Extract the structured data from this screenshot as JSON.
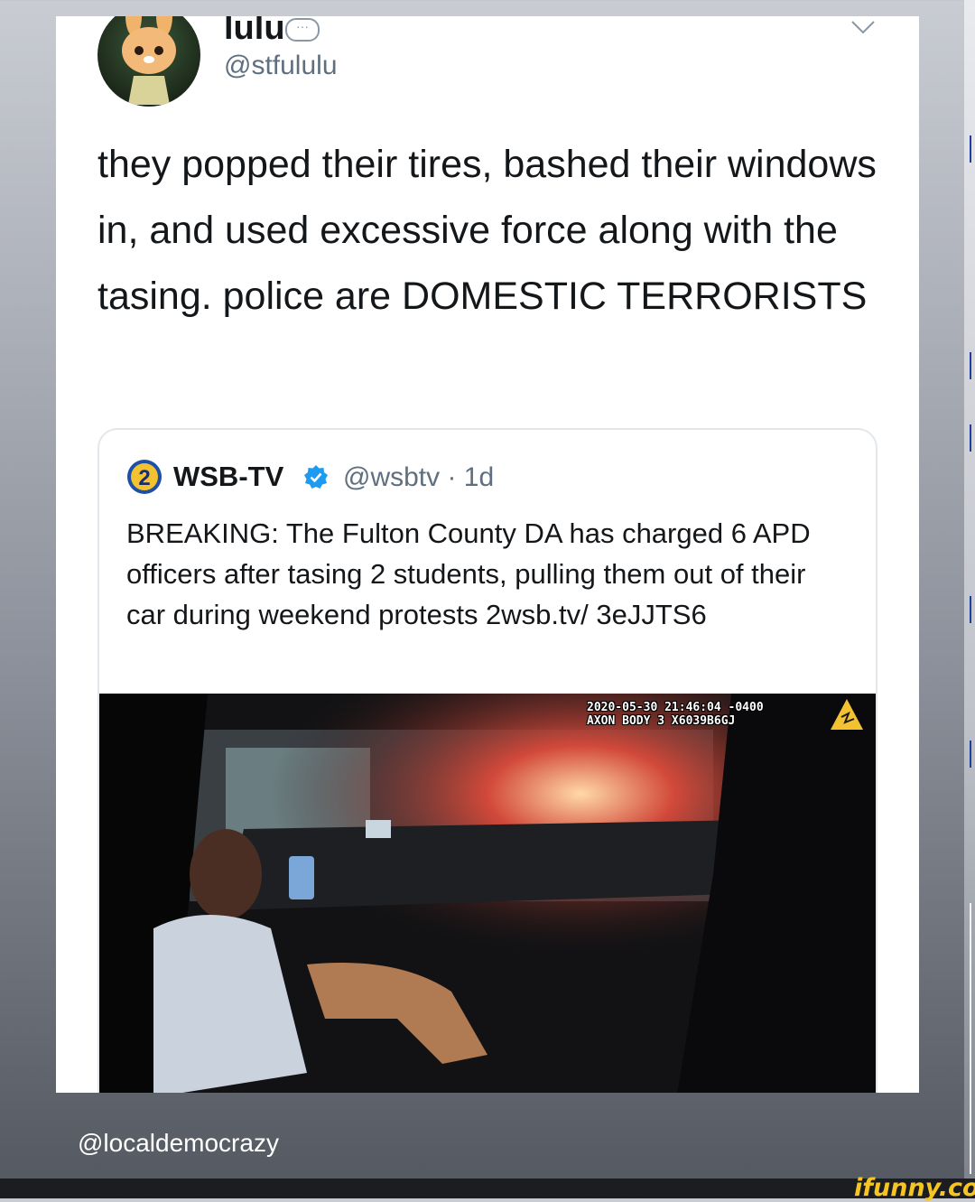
{
  "tweet": {
    "display_name": "lulu",
    "name_badge_icon": "speech-bubble-icon",
    "handle": "@stfululu",
    "text": "they popped their tires, bashed their windows in, and used excessive force along with the tasing. police are DOMESTIC TERRORISTS",
    "menu_icon": "chevron-down-icon"
  },
  "quoted": {
    "logo_text": "2",
    "name": "WSB-TV",
    "verified_icon": "verified-badge-icon",
    "handle_time": "@wsbtv · 1d",
    "text": "BREAKING: The Fulton County DA has charged 6 APD officers after tasing 2 students, pulling them out of their car during weekend protests 2wsb.tv/ 3eJJTS6",
    "media": {
      "timestamp_line": "2020-05-30 21:46:04 -0400",
      "device_line": "AXON BODY 3 X6039B6GJ"
    }
  },
  "footer": {
    "credit": "@localdemocrazy",
    "watermark": "ifunny.co"
  },
  "colors": {
    "card_bg": "#ffffff",
    "text_primary": "#14171a",
    "text_secondary": "#5f6f80",
    "verified_blue": "#1d9bf0",
    "watermark_yellow": "#f6c521"
  }
}
